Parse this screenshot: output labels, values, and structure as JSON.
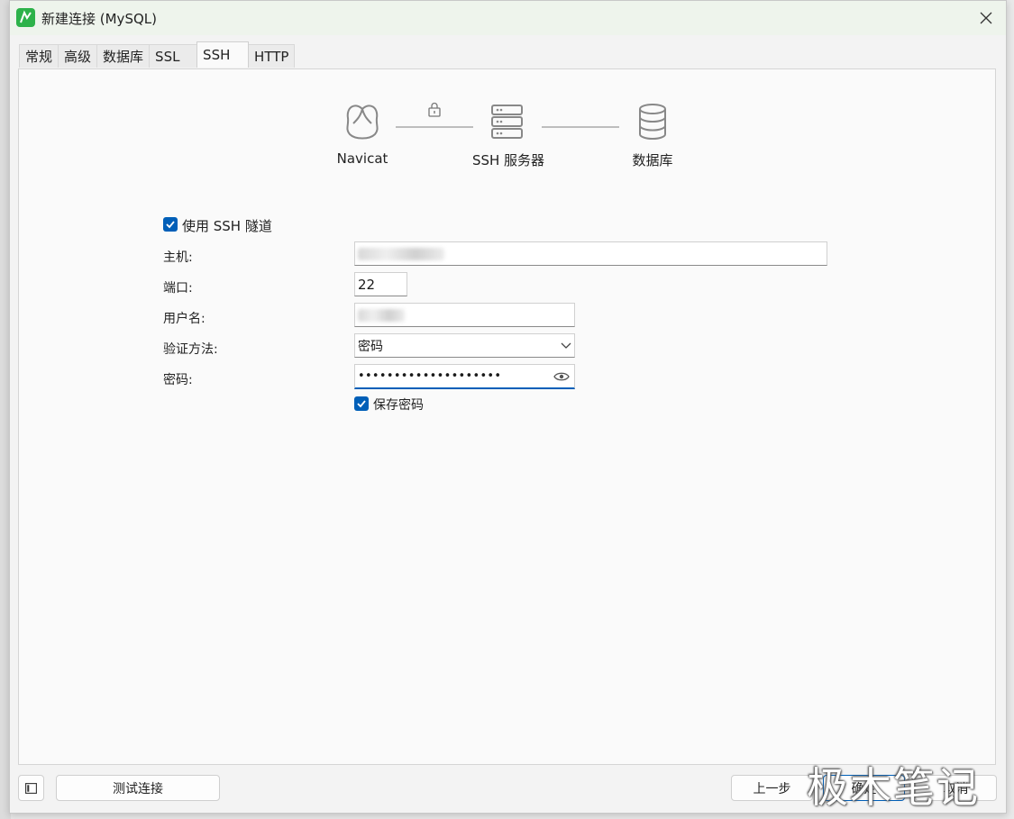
{
  "window": {
    "title": "新建连接 (MySQL)"
  },
  "tabs": [
    {
      "label": "常规",
      "active": false
    },
    {
      "label": "高级",
      "active": false
    },
    {
      "label": "数据库",
      "active": false
    },
    {
      "label": "SSL",
      "active": false
    },
    {
      "label": "SSH",
      "active": true
    },
    {
      "label": "HTTP",
      "active": false
    }
  ],
  "diagram": {
    "client": "Navicat",
    "server": "SSH 服务器",
    "database": "数据库"
  },
  "form": {
    "use_ssh_label": "使用 SSH 隧道",
    "use_ssh_checked": true,
    "host_label": "主机:",
    "port_label": "端口:",
    "port_value": "22",
    "username_label": "用户名:",
    "auth_label": "验证方法:",
    "auth_value": "密码",
    "password_label": "密码:",
    "password_value": "••••••••••••••••••••",
    "save_password_label": "保存密码",
    "save_password_checked": true
  },
  "footer": {
    "test_button": "测试连接",
    "prev_button": "上一步",
    "ok_button": "确定",
    "cancel_button": "取消"
  },
  "watermark": "极木笔记",
  "colors": {
    "accent": "#005fb8",
    "titlebar": "#eef4ec",
    "app_icon": "#2db24a"
  }
}
